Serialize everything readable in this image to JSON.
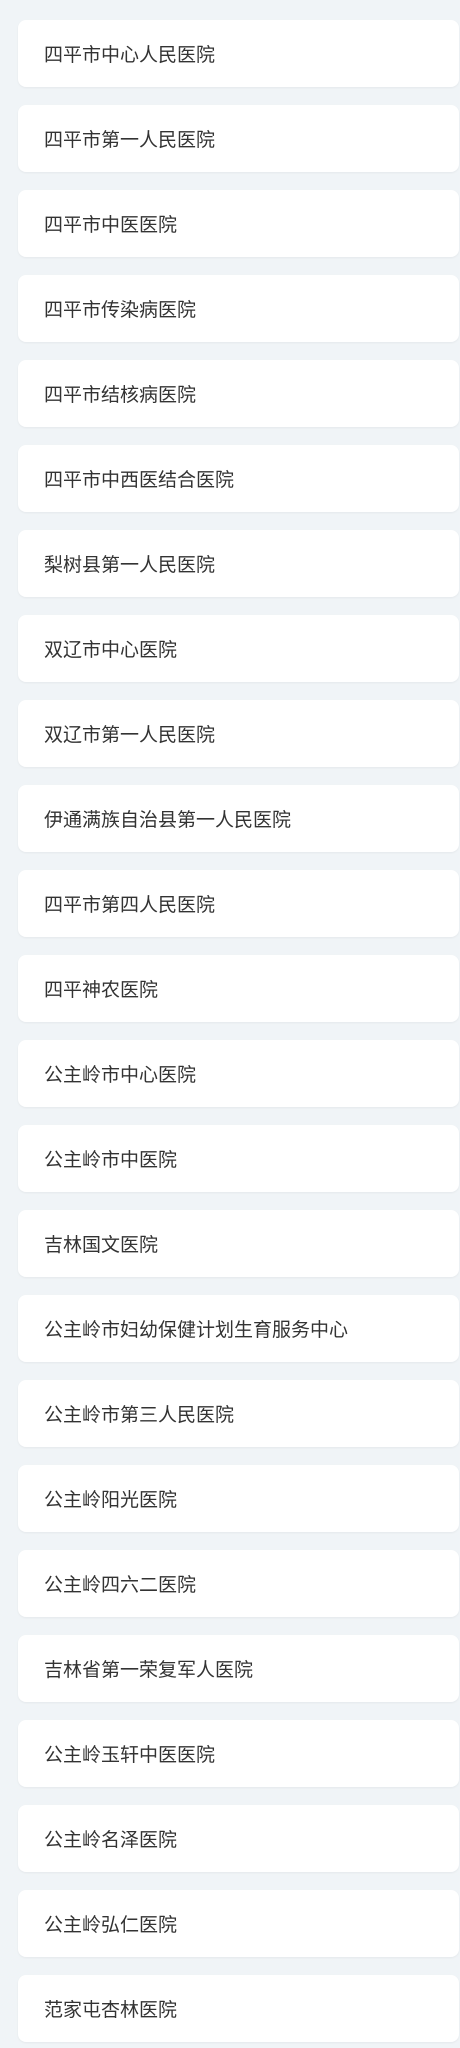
{
  "hospitals": [
    {
      "name": "四平市中心人民医院"
    },
    {
      "name": "四平市第一人民医院"
    },
    {
      "name": "四平市中医医院"
    },
    {
      "name": "四平市传染病医院"
    },
    {
      "name": "四平市结核病医院"
    },
    {
      "name": "四平市中西医结合医院"
    },
    {
      "name": "梨树县第一人民医院"
    },
    {
      "name": "双辽市中心医院"
    },
    {
      "name": "双辽市第一人民医院"
    },
    {
      "name": "伊通满族自治县第一人民医院"
    },
    {
      "name": "四平市第四人民医院"
    },
    {
      "name": "四平神农医院"
    },
    {
      "name": "公主岭市中心医院"
    },
    {
      "name": "公主岭市中医院"
    },
    {
      "name": "吉林国文医院"
    },
    {
      "name": "公主岭市妇幼保健计划生育服务中心"
    },
    {
      "name": "公主岭市第三人民医院"
    },
    {
      "name": "公主岭阳光医院"
    },
    {
      "name": "公主岭四六二医院"
    },
    {
      "name": "吉林省第一荣复军人医院"
    },
    {
      "name": "公主岭玉轩中医医院"
    },
    {
      "name": "公主岭名泽医院"
    },
    {
      "name": "公主岭弘仁医院"
    },
    {
      "name": "范家屯杏林医院"
    }
  ]
}
